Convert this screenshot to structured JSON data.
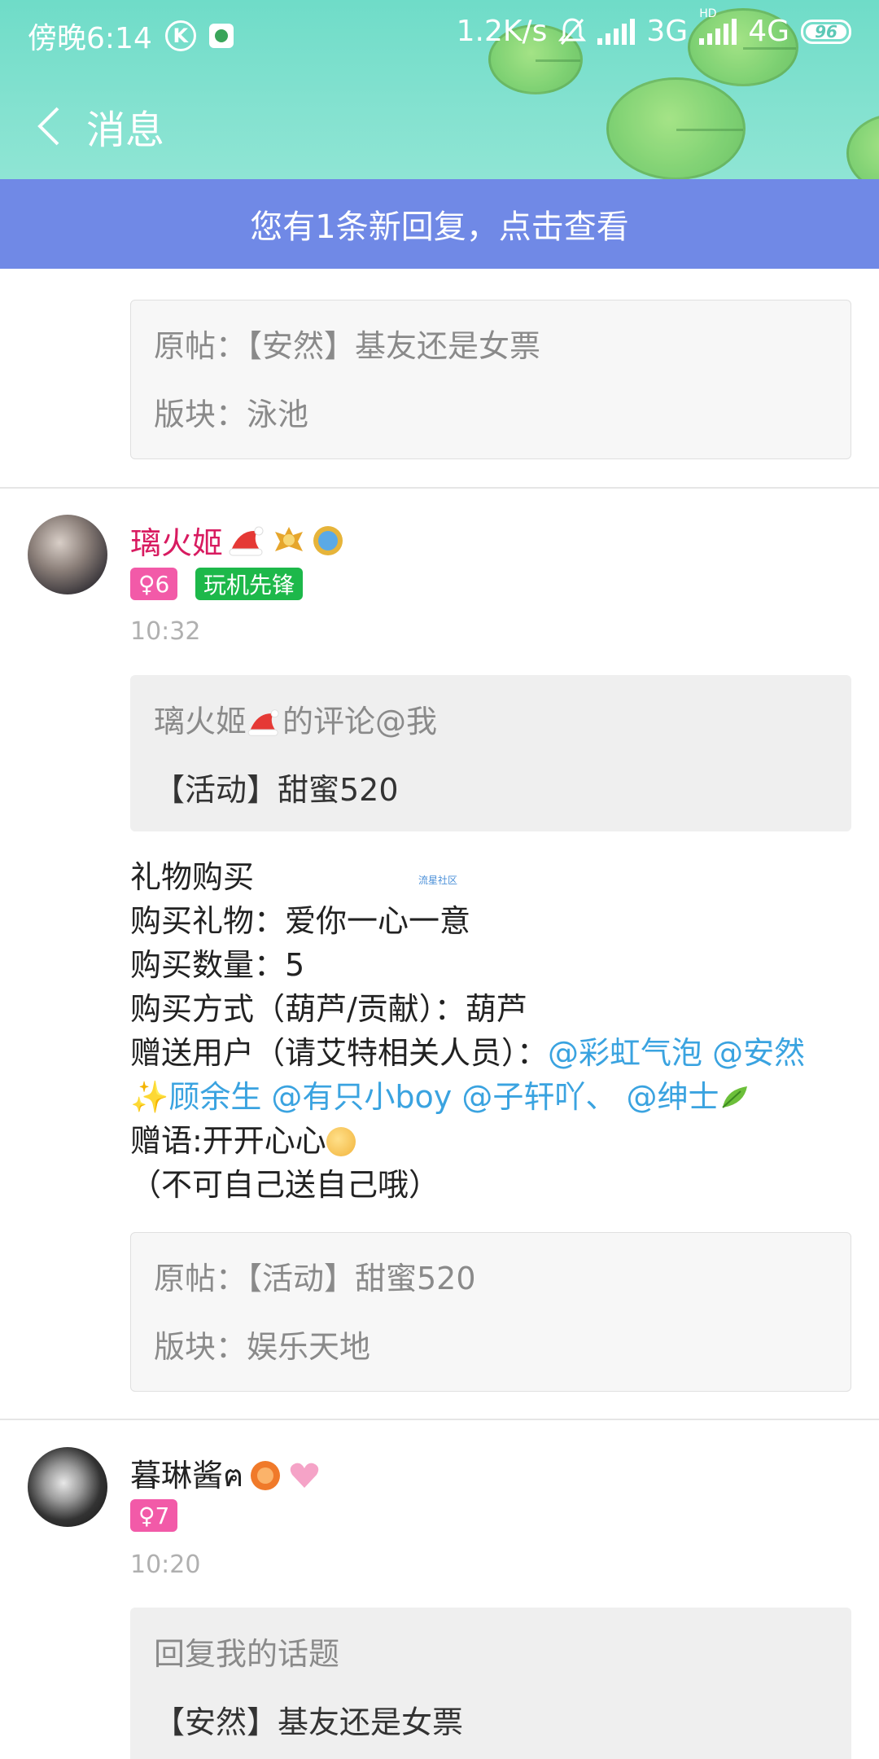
{
  "status_bar": {
    "time": "傍晚6:14",
    "k_label": "K",
    "speed": "1.2K/s",
    "net_3g": "3G",
    "net_4g": "4G",
    "hd": "HD",
    "battery": "96"
  },
  "nav": {
    "title": "消息"
  },
  "banner": {
    "text": "您有1条新回复，点击查看"
  },
  "post1": {
    "origin": "原帖：【安然】基友还是女票",
    "board": "版块：泳池"
  },
  "msg1": {
    "username": "璃火姬",
    "gender_level": "♀6",
    "title_tag": "玩机先锋",
    "time": "10:32",
    "quote_title": "璃火姬",
    "quote_suffix": "的评论@我",
    "quote_subject": "【活动】甜蜜520",
    "watermark": "流星社区",
    "body": {
      "l1": "礼物购买",
      "l2": "购买礼物：爱你一心一意",
      "l3": "购买数量：5",
      "l4": "购买方式（葫芦/贡献）：葫芦",
      "l5_prefix": "赠送用户（请艾特相关人员）：",
      "l5_m1": "@彩虹气泡",
      "l5_m2": "@安然",
      "l6_m1": "✨顾余生",
      "l6_m2": "@有只小boy",
      "l6_m3": "@子轩吖、",
      "l6_m4": "@绅士",
      "l7": "赠语:开开心心",
      "l8": "（不可自己送自己哦）"
    },
    "origin": "原帖：【活动】甜蜜520",
    "board": "版块：娱乐天地"
  },
  "msg2": {
    "username": "暮琳酱ฅ",
    "gender_level": "♀7",
    "time": "10:20",
    "quote_title": "回复我的话题",
    "quote_subject": "【安然】基友还是女票"
  },
  "colors": {
    "header": "#6fdcc8",
    "banner": "#7089e6",
    "pink_name": "#d81b60",
    "tag_pink": "#f25aa8",
    "tag_green": "#1db84a",
    "mention": "#3aa3e0"
  }
}
